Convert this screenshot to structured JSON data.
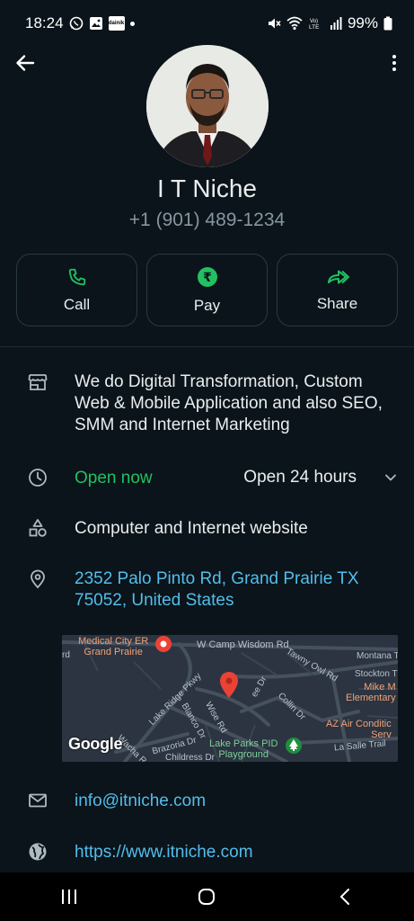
{
  "status_bar": {
    "time": "18:24",
    "battery": "99%",
    "news_badge": "dainik"
  },
  "contact": {
    "name": "I T Niche",
    "phone": "+1 (901) 489-1234"
  },
  "actions": {
    "call_label": "Call",
    "pay_label": "Pay",
    "share_label": "Share"
  },
  "business": {
    "description": "We do Digital Transformation, Custom Web & Mobile Application and also SEO, SMM and Internet Marketing",
    "open_status": "Open now",
    "hours": "Open 24 hours",
    "category": "Computer and Internet website",
    "address": "2352 Palo Pinto Rd, Grand Prairie TX 75052, United States",
    "email": "info@itniche.com",
    "website": "https://www.itniche.com"
  },
  "map": {
    "labels": {
      "medical_city": "Medical City ER\nGrand Prairie",
      "w_camp_wisdom": "W Camp Wisdom Rd",
      "tawny_owl": "Tawny Owl Rd",
      "montana": "Montana T",
      "stockton": "Stockton T",
      "mike_m": "Mike M\nElementary",
      "lake_ridge": "Lake Ridge Pkwy",
      "blanco": "Blanco Dr",
      "wise": "Wise Rd",
      "collin": "Collin Dr",
      "brazoria": "Brazoria Dr",
      "lake_parks": "Lake Parks PID\nPlayground",
      "az_air": "AZ Air Conditic\nServ",
      "la_salle": "La Salle Trail",
      "childress": "Childress Dr",
      "wacha": "Wacha Rd",
      "ee_dr": "ee Dr",
      "rd": "rd"
    },
    "google": "Google"
  }
}
